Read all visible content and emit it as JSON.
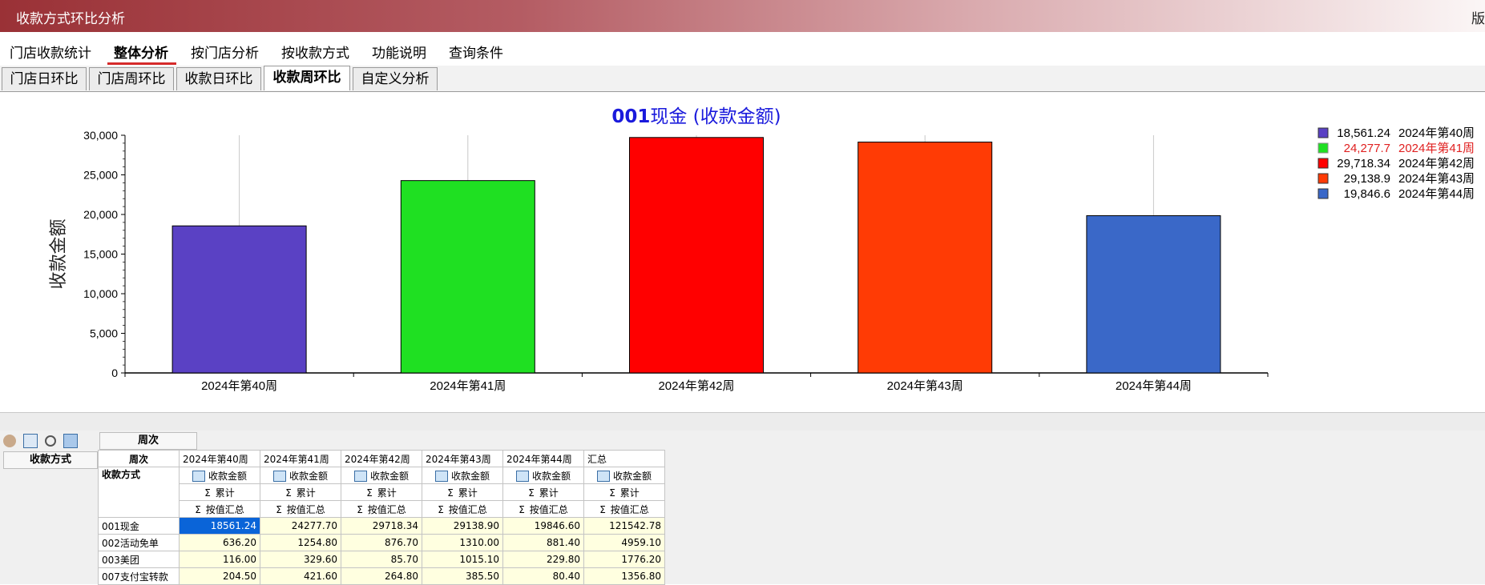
{
  "window": {
    "title": "收款方式环比分析",
    "right_text": "版"
  },
  "menu": {
    "items": [
      {
        "label": "门店收款统计"
      },
      {
        "label": "整体分析"
      },
      {
        "label": "按门店分析"
      },
      {
        "label": "按收款方式"
      },
      {
        "label": "功能说明"
      },
      {
        "label": "查询条件"
      }
    ],
    "active_index": 1
  },
  "tabs": {
    "items": [
      {
        "label": "门店日环比"
      },
      {
        "label": "门店周环比"
      },
      {
        "label": "收款日环比"
      },
      {
        "label": "收款周环比"
      },
      {
        "label": "自定义分析"
      }
    ],
    "active_index": 3
  },
  "chart_data": {
    "type": "bar",
    "title_prefix": "001",
    "title_rest": "现金 (收款金额)",
    "ylabel": "收款金额",
    "categories": [
      "2024年第40周",
      "2024年第41周",
      "2024年第42周",
      "2024年第43周",
      "2024年第44周"
    ],
    "values": [
      18561.24,
      24277.7,
      29718.34,
      29138.9,
      19846.6
    ],
    "value_labels": [
      "18,561.24",
      "24,277.7",
      "29,718.34",
      "29,138.9",
      "19,846.6"
    ],
    "colors": [
      "#5a41c4",
      "#1fe022",
      "#ff0000",
      "#ff3b05",
      "#3a68c8"
    ],
    "ylim": [
      0,
      30000
    ],
    "yticks": [
      0,
      5000,
      10000,
      15000,
      20000,
      25000,
      30000
    ],
    "ytick_labels": [
      "0",
      "5,000",
      "10,000",
      "15,000",
      "20,000",
      "25,000",
      "30,000"
    ],
    "grid": false,
    "legend_position": "top-right",
    "legend_highlight_index": 1,
    "legend_highlight_color": "#e02020"
  },
  "pivot": {
    "column_field": "周次",
    "row_field": "收款方式",
    "row_header": "周次",
    "row_subheader": "收款方式",
    "columns": [
      "2024年第40周",
      "2024年第41周",
      "2024年第42周",
      "2024年第43周",
      "2024年第44周",
      "汇总"
    ],
    "measure": "收款金额",
    "agg1": "累计",
    "agg2": "按值汇总",
    "rows": [
      {
        "label": "001现金",
        "values": [
          "18561.24",
          "24277.70",
          "29718.34",
          "29138.90",
          "19846.60",
          "121542.78"
        ]
      },
      {
        "label": "002活动免单",
        "values": [
          "636.20",
          "1254.80",
          "876.70",
          "1310.00",
          "881.40",
          "4959.10"
        ]
      },
      {
        "label": "003美团",
        "values": [
          "116.00",
          "329.60",
          "85.70",
          "1015.10",
          "229.80",
          "1776.20"
        ]
      },
      {
        "label": "007支付宝转款",
        "values": [
          "204.50",
          "421.60",
          "264.80",
          "385.50",
          "80.40",
          "1356.80"
        ]
      }
    ]
  }
}
